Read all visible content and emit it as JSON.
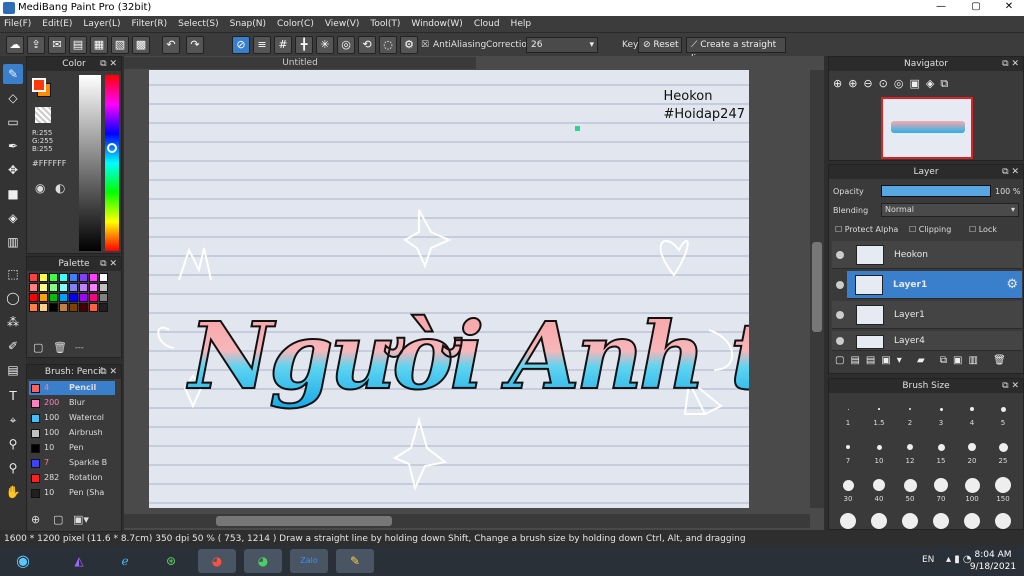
{
  "app": {
    "title": "MediBang Paint Pro (32bit)",
    "window_controls": [
      "—",
      "▢",
      "✕"
    ]
  },
  "menu": [
    "File(F)",
    "Edit(E)",
    "Layer(L)",
    "Filter(R)",
    "Select(S)",
    "Snap(N)",
    "Color(C)",
    "View(V)",
    "Tool(T)",
    "Window(W)",
    "Cloud",
    "Help"
  ],
  "toolbar": {
    "antialiasing_label": "AntiAliasing",
    "correction_label": "Correction",
    "correction_value": "26",
    "key_label": "Key",
    "reset_label": "Reset",
    "straight_line_label": "Create a straight line"
  },
  "color_panel": {
    "title": "Color",
    "r": "R:255",
    "g": "G:255",
    "b": "B:255",
    "hex": "#FFFFFF",
    "primary_color": "#ff3a0a",
    "secondary_color": "#ff8a00"
  },
  "palette": {
    "title": "Palette",
    "more": "---",
    "swatches": [
      "#ff4040",
      "#ffff40",
      "#40ff40",
      "#40ffff",
      "#4080ff",
      "#8040ff",
      "#ff40ff",
      "#ffffff",
      "#ff8080",
      "#ffff80",
      "#80ff80",
      "#80ffff",
      "#8080ff",
      "#c080ff",
      "#ff80ff",
      "#c0c0c0",
      "#ff0000",
      "#ffa000",
      "#00c000",
      "#00a0ff",
      "#0000ff",
      "#a000ff",
      "#ff0080",
      "#808080",
      "#ff8040",
      "#ffd080",
      "#000000",
      "#c08040",
      "#804000",
      "#400000",
      "#ff6040",
      "#202020"
    ]
  },
  "brush_panel": {
    "title": "Brush: Pencil",
    "items": [
      {
        "num": "4",
        "label": "Pencil",
        "color": "#ff6060"
      },
      {
        "num": "200",
        "label": "Blur",
        "color": "#ff80c0"
      },
      {
        "num": "100",
        "label": "Watercol",
        "color": "#40c0ff"
      },
      {
        "num": "100",
        "label": "Airbrush",
        "color": "#c0c0c0"
      },
      {
        "num": "10",
        "label": "Pen",
        "color": "#000000"
      },
      {
        "num": "7",
        "label": "Sparkle B",
        "color": "#4040ff"
      },
      {
        "num": "282",
        "label": "Rotation",
        "color": "#ff2020"
      },
      {
        "num": "10",
        "label": "Pen (Sha",
        "color": "#202020"
      }
    ]
  },
  "canvas": {
    "tab_title": "Untitled",
    "watermark_line1": "Heokon",
    "watermark_line2": "#Hoidap247",
    "lettering": "Người Anh tốt"
  },
  "navigator": {
    "title": "Navigator"
  },
  "layer_panel": {
    "title": "Layer",
    "opacity_label": "Opacity",
    "opacity_value": "100 %",
    "opacity_fraction": 1.0,
    "blending_label": "Blending",
    "blending_value": "Normal",
    "protect_alpha": "Protect Alpha",
    "clipping": "Clipping",
    "lock": "Lock",
    "layers": [
      {
        "name": "Heokon",
        "selected": false
      },
      {
        "name": "Layer1",
        "selected": true
      },
      {
        "name": "Layer1",
        "selected": false
      },
      {
        "name": "Layer4",
        "selected": false
      }
    ]
  },
  "brush_size": {
    "title": "Brush Size",
    "sizes": [
      "1",
      "1.5",
      "2",
      "3",
      "4",
      "5",
      "7",
      "10",
      "12",
      "15",
      "20",
      "25",
      "30",
      "40",
      "50",
      "70",
      "100",
      "150"
    ]
  },
  "status": {
    "text": "1600 * 1200 pixel  (11.6 * 8.7cm)  350 dpi  50 %  ( 753, 1214 )  Draw a straight line by holding down Shift, Change a brush size by holding down Ctrl, Alt, and dragging"
  },
  "taskbar": {
    "language": "EN",
    "time": "8:04 AM",
    "date": "9/18/2021",
    "apps": [
      "start-orb",
      "visual-studio",
      "internet-explorer",
      "zalo-green",
      "chrome",
      "chrome-alt",
      "zalo",
      "medibang"
    ]
  }
}
